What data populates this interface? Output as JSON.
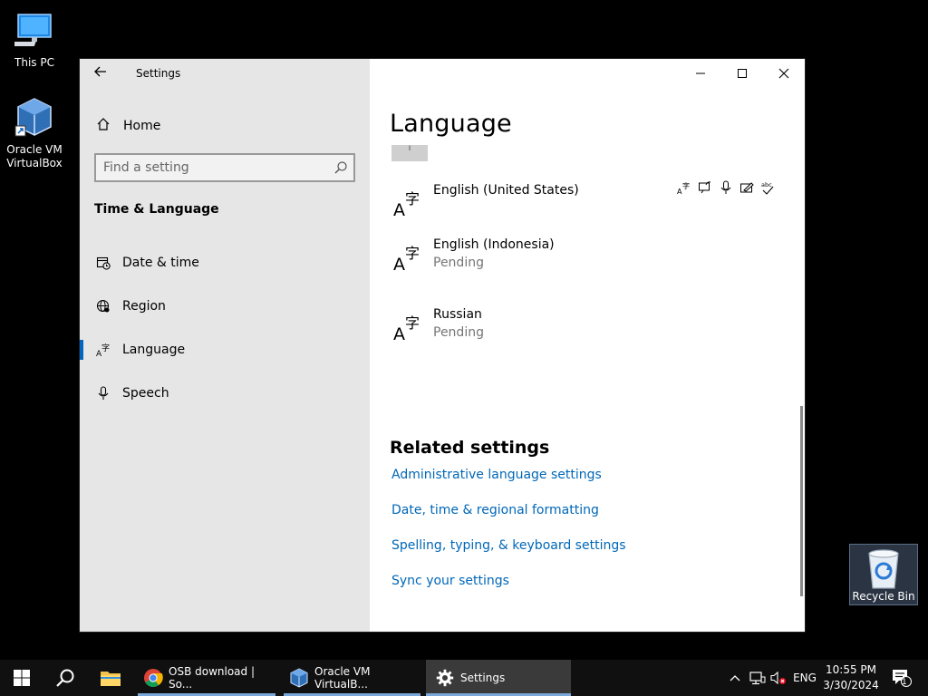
{
  "desktop": {
    "icons": [
      {
        "label": "This PC"
      },
      {
        "label": "Oracle VM VirtualBox"
      }
    ],
    "recycle_bin": {
      "label": "Recycle Bin"
    }
  },
  "window": {
    "app_title": "Settings",
    "nav": {
      "home_label": "Home",
      "search_placeholder": "Find a setting",
      "section": "Time & Language",
      "items": [
        {
          "label": "Date & time",
          "icon": "calendar-clock-icon"
        },
        {
          "label": "Region",
          "icon": "globe-icon"
        },
        {
          "label": "Language",
          "icon": "language-icon",
          "active": true
        },
        {
          "label": "Speech",
          "icon": "microphone-icon"
        }
      ]
    },
    "content": {
      "title": "Language",
      "languages": [
        {
          "name": "English (United States)",
          "status": ""
        },
        {
          "name": "English (Indonesia)",
          "status": "Pending"
        },
        {
          "name": "Russian",
          "status": "Pending"
        }
      ],
      "related_title": "Related settings",
      "links": [
        "Administrative language settings",
        "Date, time & regional formatting",
        "Spelling, typing, & keyboard settings",
        "Sync your settings"
      ]
    }
  },
  "taskbar": {
    "apps": [
      {
        "label": "OSB download | So...",
        "icon": "chrome-icon"
      },
      {
        "label": "Oracle VM VirtualB...",
        "icon": "virtualbox-icon"
      },
      {
        "label": "Settings",
        "icon": "gear-icon",
        "active": true
      }
    ],
    "tray": {
      "input_lang": "ENG",
      "time": "10:55 PM",
      "date": "3/30/2024",
      "notification_count": "1"
    }
  },
  "colors": {
    "accent": "#0067c0",
    "link": "#0067b8",
    "nav_bg": "#e6e6e6",
    "taskbar_bg": "#101010"
  }
}
